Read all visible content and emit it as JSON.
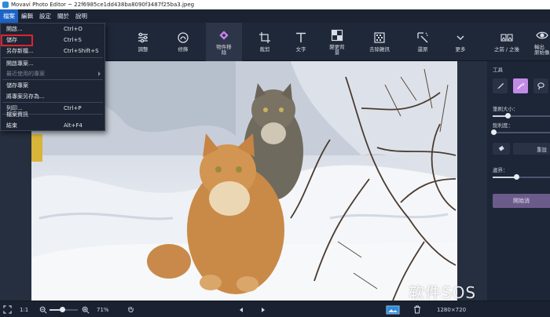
{
  "window": {
    "title": "Movavi Photo Editor ~ 22f6985ce1dd438ba8090f3487f25ba3.jpeg"
  },
  "menubar": {
    "items": [
      "檔案",
      "編輯",
      "設定",
      "關於",
      "說明"
    ]
  },
  "toolbar": {
    "adjust": "調整",
    "retouch": "修飾",
    "object_removal": "物件移除",
    "crop": "裁剪",
    "text": "文字",
    "change_bg": "變更背景",
    "denoise": "去除雜訊",
    "restore": "還原",
    "more": "更多",
    "before_after": "之前 / 之後",
    "output_line1": "輸出",
    "output_line2": "原始像"
  },
  "file_menu": {
    "items": [
      {
        "label": "開啟...",
        "shortcut": "Ctrl+O"
      },
      {
        "label": "儲存",
        "shortcut": "Ctrl+S"
      },
      {
        "label": "另存新檔...",
        "shortcut": "Ctrl+Shift+S"
      },
      {
        "label": "開啟專案...",
        "shortcut": ""
      },
      {
        "label": "最近使用的專案",
        "shortcut": ""
      },
      {
        "label": "儲存專案",
        "shortcut": ""
      },
      {
        "label": "將專案另存為...",
        "shortcut": ""
      },
      {
        "label": "列印...",
        "shortcut": "Ctrl+P"
      },
      {
        "label": "檔案資訊",
        "shortcut": ""
      },
      {
        "label": "結束",
        "shortcut": "Alt+F4"
      }
    ]
  },
  "right_panel": {
    "heading": "工具",
    "brush_size": "筆刷大小：",
    "sharpness": "銳利度：",
    "brush_size_level": 0.27,
    "sharpness_level": 0.02,
    "reset_label": "重設",
    "boundary": "邊界：",
    "boundary_level": 0.42,
    "start_label": "開始消"
  },
  "statusbar": {
    "fit": "1:1",
    "zoom": "71%",
    "dimensions": "1280×720",
    "zoom_level": 0.45
  },
  "watermark": "软件SOS",
  "colors": {
    "accent": "#1c64c7",
    "highlight": "#e0222b",
    "active_tool": "#c28be6"
  }
}
